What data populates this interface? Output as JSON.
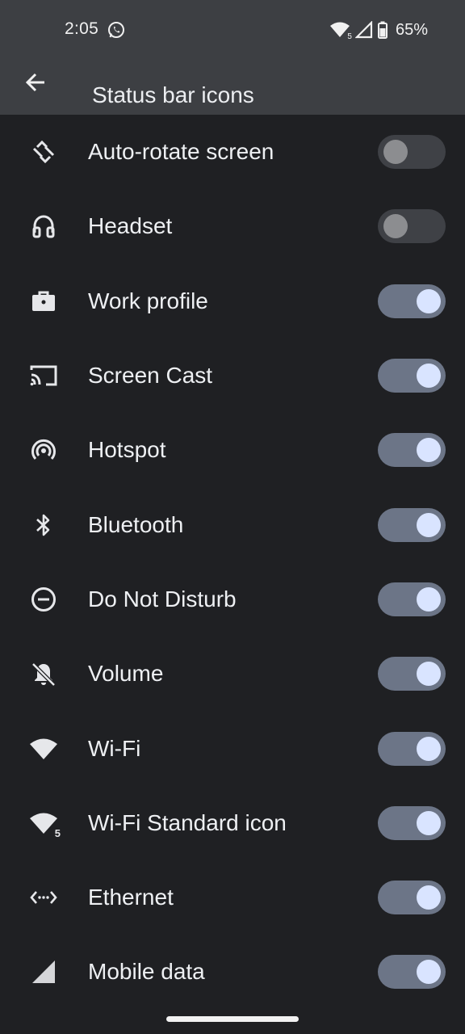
{
  "status_bar": {
    "time": "2:05",
    "wifi_badge": "5",
    "battery_percent": "65%",
    "icons": [
      "whatsapp-icon",
      "wifi-icon",
      "signal-icon",
      "battery-icon"
    ]
  },
  "app_bar": {
    "title": "Status bar icons",
    "back_icon": "arrow-back-icon"
  },
  "items": [
    {
      "label": "Auto-rotate screen",
      "icon": "auto-rotate-icon",
      "enabled": false
    },
    {
      "label": "Headset",
      "icon": "headset-icon",
      "enabled": false
    },
    {
      "label": "Work profile",
      "icon": "briefcase-icon",
      "enabled": true
    },
    {
      "label": "Screen Cast",
      "icon": "cast-icon",
      "enabled": true
    },
    {
      "label": "Hotspot",
      "icon": "hotspot-icon",
      "enabled": true
    },
    {
      "label": "Bluetooth",
      "icon": "bluetooth-icon",
      "enabled": true
    },
    {
      "label": "Do Not Disturb",
      "icon": "do-not-disturb-icon",
      "enabled": true
    },
    {
      "label": "Volume",
      "icon": "bell-off-icon",
      "enabled": true
    },
    {
      "label": "Wi-Fi",
      "icon": "wifi-icon",
      "enabled": true
    },
    {
      "label": "Wi-Fi Standard icon",
      "icon": "wifi-standard-icon",
      "enabled": true,
      "badge": "5"
    },
    {
      "label": "Ethernet",
      "icon": "ethernet-icon",
      "enabled": true
    },
    {
      "label": "Mobile data",
      "icon": "mobile-data-icon",
      "enabled": true
    }
  ],
  "colors": {
    "background": "#1f2023",
    "app_bar": "#3d3f43",
    "toggle_on_track": "#6c7587",
    "toggle_on_thumb": "#d9e4ff",
    "toggle_off_track": "#3f4146",
    "toggle_off_thumb": "#8c8d90"
  }
}
